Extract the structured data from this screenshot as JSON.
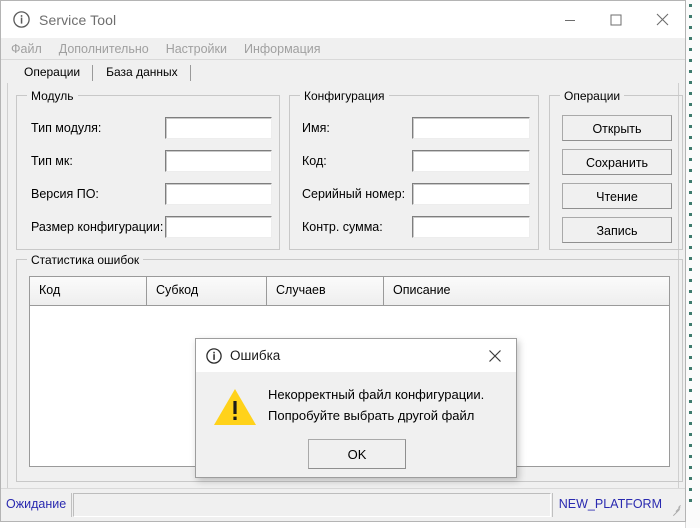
{
  "window": {
    "title": "Service Tool",
    "title_icon": "info-circle-icon",
    "controls": {
      "minimize": "minimize-icon",
      "maximize": "maximize-icon",
      "close": "close-icon"
    }
  },
  "menu": {
    "items": [
      {
        "label": "Файл",
        "enabled": false
      },
      {
        "label": "Дополнительно",
        "enabled": false
      },
      {
        "label": "Настройки",
        "enabled": false
      },
      {
        "label": "Информация",
        "enabled": false
      }
    ]
  },
  "tabs": [
    {
      "label": "Операции",
      "active": true
    },
    {
      "label": "База данных",
      "active": false
    }
  ],
  "groups": {
    "module": {
      "title": "Модуль",
      "fields": [
        {
          "label": "Тип модуля:",
          "value": ""
        },
        {
          "label": "Тип мк:",
          "value": ""
        },
        {
          "label": "Версия ПО:",
          "value": ""
        },
        {
          "label": "Размер конфигурации:",
          "value": ""
        }
      ]
    },
    "config": {
      "title": "Конфигурация",
      "fields": [
        {
          "label": "Имя:",
          "value": ""
        },
        {
          "label": "Код:",
          "value": ""
        },
        {
          "label": "Серийный номер:",
          "value": ""
        },
        {
          "label": "Контр. сумма:",
          "value": ""
        }
      ]
    },
    "operations": {
      "title": "Операции",
      "buttons": [
        {
          "label": "Открыть"
        },
        {
          "label": "Сохранить"
        },
        {
          "label": "Чтение"
        },
        {
          "label": "Запись"
        }
      ]
    },
    "errors": {
      "title": "Статистика ошибок",
      "columns": [
        "Код",
        "Субкод",
        "Случаев",
        "Описание"
      ],
      "rows": []
    }
  },
  "status_bar": {
    "left": "Ожидание",
    "middle": "",
    "right": "NEW_PLATFORM",
    "text_color": "#2a2ab0"
  },
  "dialog": {
    "title": "Ошибка",
    "title_icon": "info-circle-icon",
    "close_icon": "close-icon",
    "warning_icon": "warning-triangle-icon",
    "warning_color": "#ffd21a",
    "message_line1": "Некорректный файл конфигурации.",
    "message_line2": "Попробуйте выбрать другой файл",
    "ok_label": "OK"
  }
}
